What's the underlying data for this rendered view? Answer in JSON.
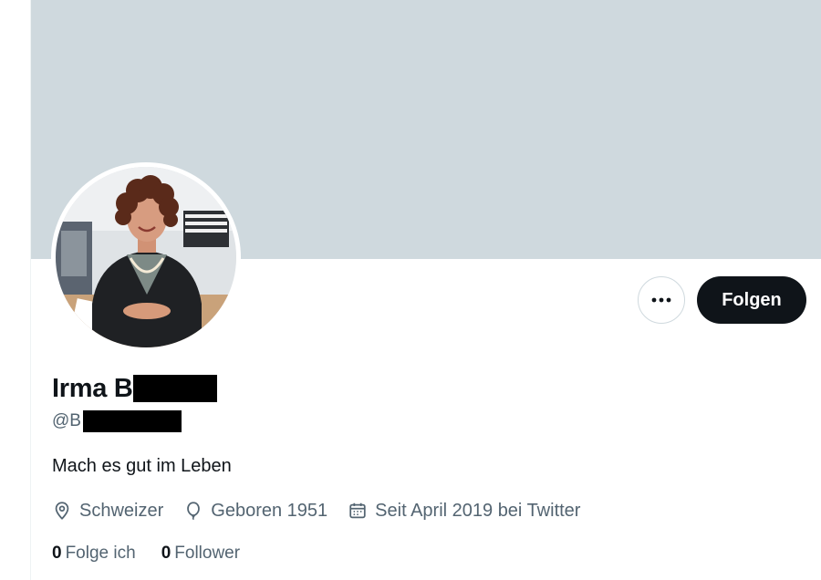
{
  "profile": {
    "display_name_visible": "Irma B",
    "handle_visible": "@B",
    "bio": "Mach es gut im Leben",
    "location": "Schweizer",
    "birth": "Geboren 1951",
    "joined": "Seit April 2019 bei Twitter",
    "following_count": "0",
    "following_label": "Folge ich",
    "followers_count": "0",
    "followers_label": "Follower"
  },
  "actions": {
    "follow_label": "Folgen",
    "more_icon": "more-dots-icon"
  },
  "colors": {
    "banner": "#cfd9de",
    "text_primary": "#0f1419",
    "text_secondary": "#536471",
    "button_dark": "#0f1419"
  }
}
